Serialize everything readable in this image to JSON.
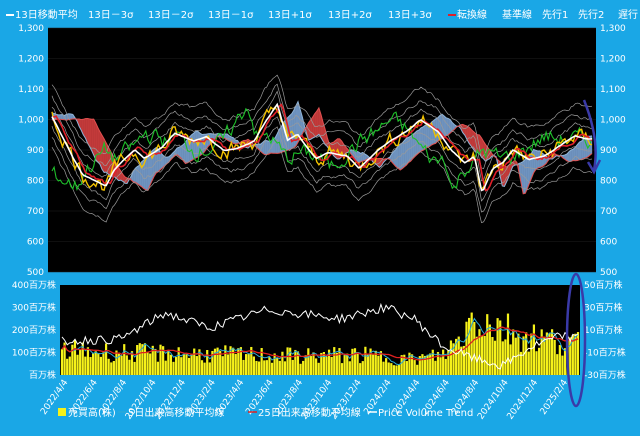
{
  "chart_data": [
    {
      "type": "line",
      "legend": [
        "13日移動平均",
        "13日－3σ",
        "13日－2σ",
        "13日－1σ",
        "13日+1σ",
        "13日+2σ",
        "13日+3σ",
        "転換線",
        "基準線",
        "先行1",
        "先行2",
        "遅行"
      ],
      "y_ticks": [
        "1,300",
        "1,200",
        "1,100",
        "1,000",
        "900",
        "800",
        "700",
        "600",
        "500"
      ],
      "ylim": [
        500,
        1300
      ],
      "colors": {
        "ma13": "#ffffff",
        "sigma": "#9a9a9a",
        "tenkan": "#e0202a",
        "kijun": "#f2c200",
        "senkou_a": "#8fb4d8",
        "senkou_b": "#e05050",
        "chikou": "#1ec02a",
        "cloud_bull": "#6f93bf",
        "cloud_bear": "#c23a3a"
      },
      "anchor_series": {
        "name": "13日移動平均",
        "x": [
          "2022/4/4",
          "2022/5/15",
          "2022/6/4",
          "2022/7/20",
          "2022/8/4",
          "2022/9/15",
          "2022/10/4",
          "2022/11/10",
          "2022/12/4",
          "2023/1/10",
          "2023/2/4",
          "2023/3/10",
          "2023/4/4",
          "2023/5/10",
          "2023/6/4",
          "2023/6/25",
          "2023/7/15",
          "2023/8/4",
          "2023/9/10",
          "2023/10/4",
          "2023/11/10",
          "2023/12/4",
          "2024/1/10",
          "2024/2/4",
          "2024/3/10",
          "2024/4/4",
          "2024/5/10",
          "2024/6/4",
          "2024/7/1",
          "2024/7/20",
          "2024/8/4",
          "2024/8/25",
          "2024/9/15",
          "2024/10/4",
          "2024/11/4",
          "2024/12/4",
          "2025/1/10",
          "2025/2/4",
          "2025/3/1"
        ],
        "values": [
          1010,
          880,
          820,
          780,
          830,
          900,
          870,
          910,
          955,
          930,
          945,
          900,
          905,
          930,
          1000,
          1050,
          930,
          950,
          870,
          890,
          880,
          840,
          900,
          930,
          965,
          1000,
          960,
          900,
          860,
          880,
          760,
          840,
          860,
          900,
          870,
          880,
          920,
          945,
          935
        ]
      }
    },
    {
      "type": "bar",
      "legend": [
        "売買高(株)",
        "5日出来高移動平均線",
        "25日出来高移動平均線",
        "Price Volume Trend"
      ],
      "x_ticks": [
        "2022/4/4",
        "2022/6/4",
        "2022/8/4",
        "2022/10/4",
        "2022/12/4",
        "2023/2/4",
        "2023/4/4",
        "2023/6/4",
        "2023/8/4",
        "2023/10/4",
        "2023/12/4",
        "2024/2/4",
        "2024/4/4",
        "2024/6/4",
        "2024/8/4",
        "2024/10/4",
        "2024/12/4",
        "2025/2/4"
      ],
      "y_left_ticks": [
        "400百万株",
        "300百万株",
        "200百万株",
        "100百万株",
        "百万株"
      ],
      "y_right_ticks": [
        "50百万株",
        "30百万株",
        "10百万株",
        "-10百万株",
        "-30百万株"
      ],
      "ylim_left": [
        0,
        400
      ],
      "ylim_right": [
        -30,
        50
      ],
      "colors": {
        "volume": "#f6f21a",
        "ma5": "#2aa8d8",
        "ma25": "#e02020",
        "pvt": "#ffffff"
      },
      "volume_anchor_x": [
        "2022/4/4",
        "2022/8/4",
        "2022/12/4",
        "2023/4/4",
        "2023/8/4",
        "2023/12/4",
        "2024/4/4",
        "2024/6/4",
        "2024/7/15",
        "2024/8/4",
        "2024/9/15",
        "2024/12/4",
        "2025/2/4",
        "2025/3/1"
      ],
      "volume_anchor_values": [
        110,
        100,
        95,
        90,
        85,
        90,
        70,
        90,
        180,
        270,
        220,
        170,
        150,
        140
      ],
      "pvt_anchor_x": [
        "2022/4/4",
        "2022/8/4",
        "2022/11/4",
        "2023/2/4",
        "2023/6/4",
        "2023/8/4",
        "2023/11/4",
        "2024/2/4",
        "2024/4/4",
        "2024/6/4",
        "2024/8/4",
        "2024/10/4",
        "2024/12/4",
        "2025/2/4",
        "2025/3/1"
      ],
      "pvt_anchor_values": [
        0,
        2,
        25,
        12,
        28,
        25,
        20,
        30,
        20,
        -5,
        -15,
        -22,
        -5,
        5,
        3
      ]
    }
  ]
}
